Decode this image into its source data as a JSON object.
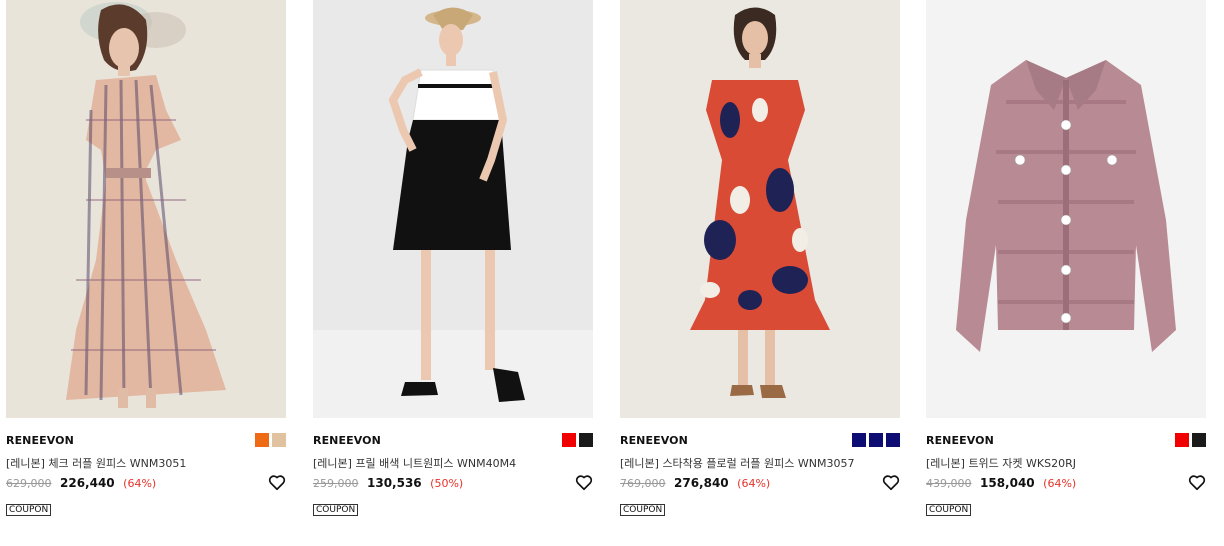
{
  "products": [
    {
      "brand": "RENEEVON",
      "name": "[레니본] 체크 러플 원피스 WNM3051",
      "original_price": "629,000",
      "sale_price": "226,440",
      "discount": "(64%)",
      "coupon": "COUPON",
      "image": "pink-check-ruffle-dress-photo",
      "swatches": [
        "#ef6a15",
        "#e0c2a0"
      ]
    },
    {
      "brand": "RENEEVON",
      "name": "[레니본] 프릴 배색 니트원피스 WNM40M4",
      "original_price": "259,000",
      "sale_price": "130,536",
      "discount": "(50%)",
      "coupon": "COUPON",
      "image": "black-white-knit-dress-photo",
      "swatches": [
        "#f00000",
        "#1a1a1a"
      ]
    },
    {
      "brand": "RENEEVON",
      "name": "[레니본] 스타착용 플로럴 러플 원피스 WNM3057",
      "original_price": "769,000",
      "sale_price": "276,840",
      "discount": "(64%)",
      "coupon": "COUPON",
      "image": "red-navy-floral-dress-photo",
      "swatches": [
        "#0c0c72",
        "#0c0c72",
        "#0c0c72"
      ]
    },
    {
      "brand": "RENEEVON",
      "name": "[레니본] 트위드 자켓 WKS20RJ",
      "original_price": "439,000",
      "sale_price": "158,040",
      "discount": "(64%)",
      "coupon": "COUPON",
      "image": "pink-tweed-jacket-photo",
      "swatches": [
        "#f00000",
        "#1a1a1a"
      ]
    }
  ],
  "icons": {
    "wishlist": "heart-outline-icon"
  }
}
